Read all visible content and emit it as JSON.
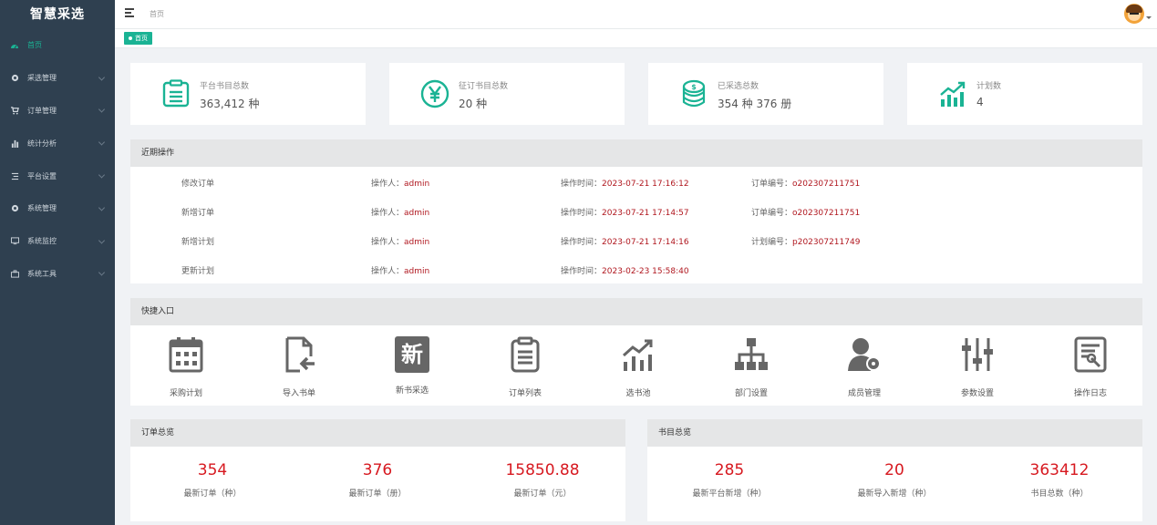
{
  "app": {
    "title": "智慧采选"
  },
  "sidebar": {
    "items": [
      {
        "label": "首页",
        "icon": "dashboard-icon"
      },
      {
        "label": "采选管理",
        "icon": "gear-icon"
      },
      {
        "label": "订单管理",
        "icon": "cart-icon"
      },
      {
        "label": "统计分析",
        "icon": "bar-chart-icon"
      },
      {
        "label": "平台设置",
        "icon": "list-icon"
      },
      {
        "label": "系统管理",
        "icon": "cog-icon"
      },
      {
        "label": "系统监控",
        "icon": "monitor-icon"
      },
      {
        "label": "系统工具",
        "icon": "toolbox-icon"
      }
    ]
  },
  "topbar": {
    "breadcrumb": "首页"
  },
  "tabs": [
    {
      "label": "首页"
    }
  ],
  "stats": [
    {
      "label": "平台书目总数",
      "value": "363,412 种",
      "icon": "document-icon"
    },
    {
      "label": "征订书目总数",
      "value": "20 种",
      "icon": "yen-icon"
    },
    {
      "label": "已采选总数",
      "value": "354 种 376 册",
      "icon": "coins-icon"
    },
    {
      "label": "计划数",
      "value": "4",
      "icon": "trend-icon"
    }
  ],
  "recent": {
    "title": "近期操作",
    "rows": [
      {
        "action": "修改订单",
        "op_label": "操作人：",
        "operator": "admin",
        "time_label": "操作时间：",
        "time": "2023-07-21 17:16:12",
        "no_label": "订单编号：",
        "no": "o202307211751"
      },
      {
        "action": "新增订单",
        "op_label": "操作人：",
        "operator": "admin",
        "time_label": "操作时间：",
        "time": "2023-07-21 17:14:57",
        "no_label": "订单编号：",
        "no": "o202307211751"
      },
      {
        "action": "新增计划",
        "op_label": "操作人：",
        "operator": "admin",
        "time_label": "操作时间：",
        "time": "2023-07-21 17:14:16",
        "no_label": "计划编号：",
        "no": "p202307211749"
      },
      {
        "action": "更新计划",
        "op_label": "操作人：",
        "operator": "admin",
        "time_label": "操作时间：",
        "time": "2023-02-23 15:58:40",
        "no_label": "",
        "no": ""
      }
    ]
  },
  "quick": {
    "title": "快捷入口",
    "items": [
      {
        "label": "采购计划",
        "icon": "calendar-icon"
      },
      {
        "label": "导入书单",
        "icon": "file-import-icon"
      },
      {
        "label": "新书采选",
        "icon": "new-badge-icon",
        "glyph": "新"
      },
      {
        "label": "订单列表",
        "icon": "clipboard-icon"
      },
      {
        "label": "选书池",
        "icon": "trend-chart-icon"
      },
      {
        "label": "部门设置",
        "icon": "org-chart-icon"
      },
      {
        "label": "成员管理",
        "icon": "user-manage-icon"
      },
      {
        "label": "参数设置",
        "icon": "sliders-icon"
      },
      {
        "label": "操作日志",
        "icon": "log-icon"
      }
    ]
  },
  "orders": {
    "title": "订单总览",
    "items": [
      {
        "value": "354",
        "caption": "最新订单（种）"
      },
      {
        "value": "376",
        "caption": "最新订单（册）"
      },
      {
        "value": "15850.88",
        "caption": "最新订单（元）"
      }
    ]
  },
  "books": {
    "title": "书目总览",
    "items": [
      {
        "value": "285",
        "caption": "最新平台新增（种）"
      },
      {
        "value": "20",
        "caption": "最新导入新增（种）"
      },
      {
        "value": "363412",
        "caption": "书目总数（种）"
      }
    ]
  },
  "colors": {
    "accent": "#1ab394",
    "sidebar": "#2f4050",
    "number": "#d71920",
    "operator": "#b0171f"
  }
}
